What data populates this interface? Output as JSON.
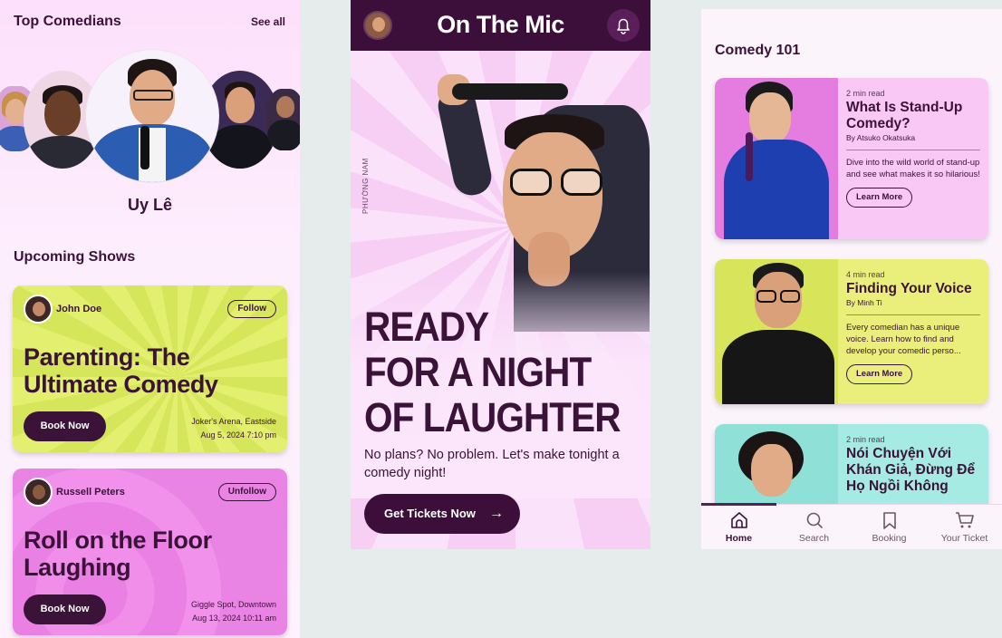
{
  "left": {
    "top_title": "Top Comedians",
    "see_all": "See all",
    "featured_name": "Uy Lê",
    "upcoming_title": "Upcoming Shows",
    "shows": [
      {
        "host": "John Doe",
        "follow": "Follow",
        "title": "Parenting: The Ultimate Comedy",
        "book": "Book Now",
        "venue": "Joker's Arena, Eastside",
        "date": "Aug 5, 2024 7:10 pm"
      },
      {
        "host": "Russell Peters",
        "follow": "Unfollow",
        "title": "Roll on the Floor Laughing",
        "book": "Book Now",
        "venue": "Giggle Spot, Downtown",
        "date": "Aug 13, 2024 10:11 am"
      }
    ]
  },
  "mid": {
    "app_title": "On The Mic",
    "credit": "PHƯỜNG NAM",
    "headline_1": "READY",
    "headline_2": "FOR A NIGHT",
    "headline_3": "OF LAUGHTER",
    "subtitle": "No plans? No problem. Let's make tonight a comedy night!",
    "cta": "Get Tickets Now",
    "cta_arrow": "→"
  },
  "right": {
    "section_title": "Comedy 101",
    "articles": [
      {
        "read": "2 min read",
        "title": "What Is Stand-Up Comedy?",
        "by": "By Atsuko Okatsuka",
        "excerpt": "Dive into the wild world of stand-up and see what makes it so hilarious!",
        "button": "Learn More"
      },
      {
        "read": "4 min read",
        "title": "Finding Your Voice",
        "by": "By Minh Ti",
        "excerpt": "Every comedian has a unique voice. Learn how to find and develop your comedic perso...",
        "button": "Learn More"
      },
      {
        "read": "2 min read",
        "title": "Nói Chuyện Với Khán Giả, Đừng Để Họ Ngồi Không",
        "by": "",
        "excerpt": "",
        "button": ""
      }
    ],
    "tabs": [
      {
        "label": "Home",
        "icon": "home-icon"
      },
      {
        "label": "Search",
        "icon": "search-icon"
      },
      {
        "label": "Booking",
        "icon": "bookmark-icon"
      },
      {
        "label": "Your Ticket",
        "icon": "cart-icon"
      }
    ]
  },
  "colors": {
    "primary": "#3b1238",
    "yellow_card": "#e3ef6e",
    "pink_card": "#ea80e4",
    "teal_card": "#a6ebe3"
  }
}
